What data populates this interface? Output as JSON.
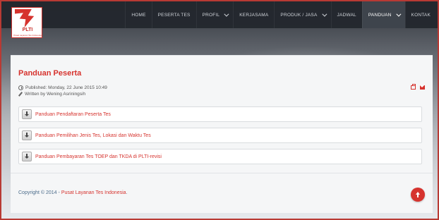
{
  "logo": {
    "text": "PLTI",
    "subtext": "Pusat Layanan Tes Indonesia"
  },
  "nav": {
    "items": [
      {
        "label": "HOME",
        "dropdown": false,
        "active": false
      },
      {
        "label": "PESERTA TES",
        "dropdown": false,
        "active": false
      },
      {
        "label": "PROFIL",
        "dropdown": true,
        "active": false
      },
      {
        "label": "KERJASAMA",
        "dropdown": false,
        "active": false
      },
      {
        "label": "PRODUK / JASA",
        "dropdown": true,
        "active": false
      },
      {
        "label": "JADWAL",
        "dropdown": false,
        "active": false
      },
      {
        "label": "PANDUAN",
        "dropdown": true,
        "active": true
      },
      {
        "label": "KONTAK",
        "dropdown": false,
        "active": false
      }
    ]
  },
  "article": {
    "title": "Panduan Peserta",
    "published": "Published: Monday, 22 June 2015 10:49",
    "author": "Written by Wening Asriningsih",
    "documents": [
      "Panduan Pendaftaran Peserta Tes",
      "Panduan Pemilihan Jenis Tes, Lokasi dan Waktu Tes",
      "Panduan Pembayaran Tes TOEP dan TKDA di PLTI-revisi"
    ]
  },
  "footer": {
    "copyright_prefix": "Copyright © 2014 - ",
    "copyright_link": "Pusat Layanan Tes Indonesia",
    "copyright_suffix": "."
  },
  "colors": {
    "accent": "#d6332e",
    "nav_bg": "#22262c"
  }
}
